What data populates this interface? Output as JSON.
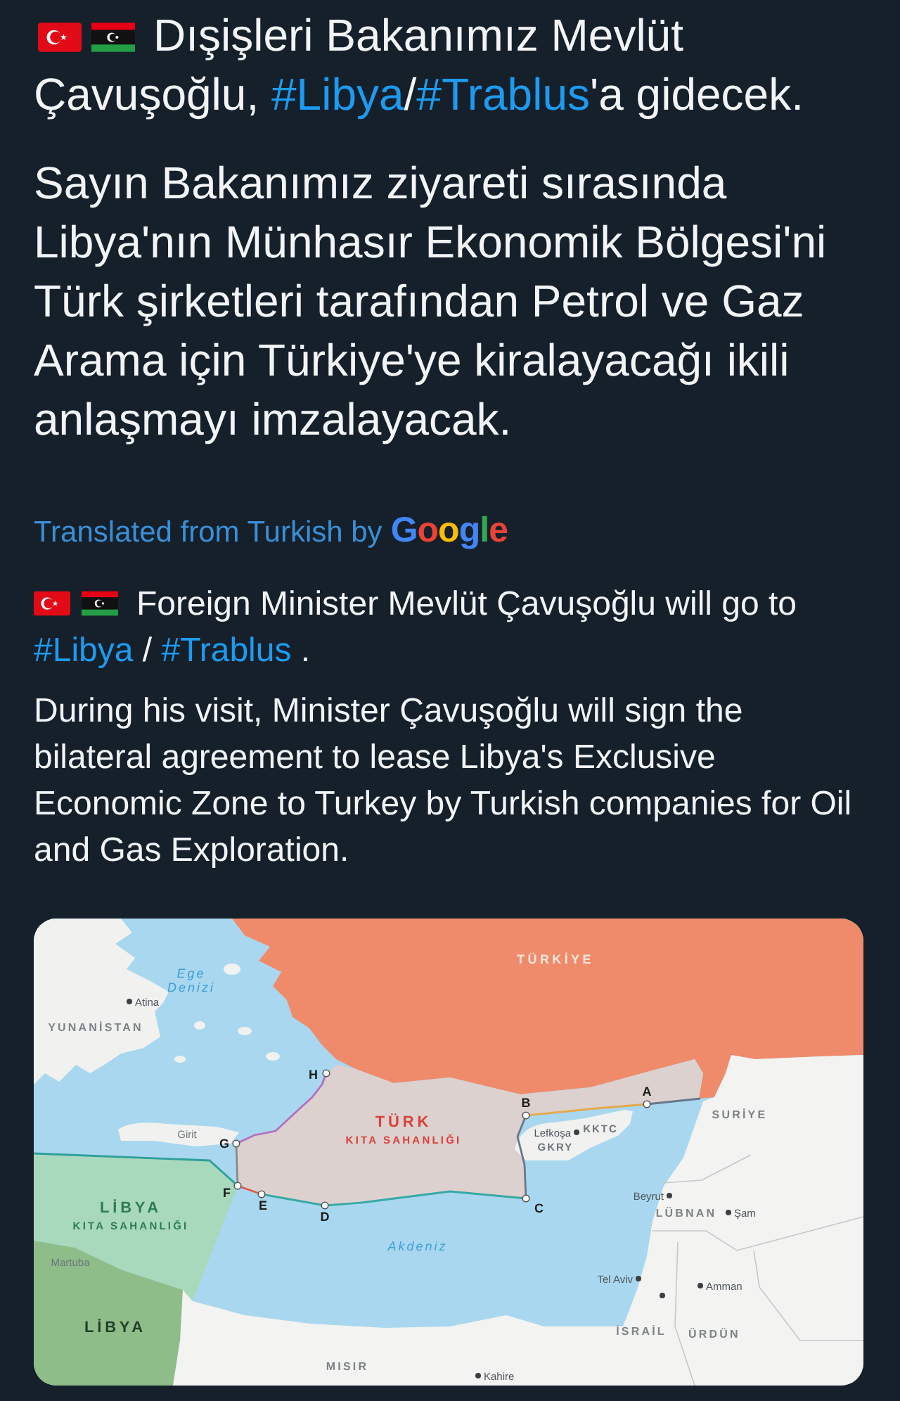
{
  "original": {
    "headline": [
      {
        "kind": "text",
        "text": "Dışişleri Bakanımız Mevlüt Çavuşoğlu, "
      },
      {
        "kind": "hashtag",
        "text": "#Libya"
      },
      {
        "kind": "text",
        "text": "/"
      },
      {
        "kind": "hashtag",
        "text": "#Trablus"
      },
      {
        "kind": "text",
        "text": "'a gidecek."
      }
    ],
    "body": "Sayın Bakanımız ziyareti sırasında Libya'nın Münhasır Ekonomik Bölgesi'ni Türk şirketleri tarafından Petrol ve Gaz Arama için Türkiye'ye kiralayacağı ikili anlaşmayı imzalayacak."
  },
  "translation": {
    "note": "Translated from Turkish by",
    "provider": "Google",
    "headline": [
      {
        "kind": "text",
        "text": "Foreign Minister Mevlüt Çavuşoğlu will go to "
      },
      {
        "kind": "hashtag",
        "text": "#Libya"
      },
      {
        "kind": "text",
        "text": " / "
      },
      {
        "kind": "hashtag",
        "text": "#Trablus"
      },
      {
        "kind": "text",
        "text": " ."
      }
    ],
    "body": "During his visit, Minister Çavuşoğlu will sign the bilateral agreement to lease Libya's Exclusive Economic Zone to Turkey by Turkish companies for Oil and Gas Exploration."
  },
  "map": {
    "countries": [
      "TÜRKİYE",
      "YUNANİSTAN",
      "SURİYE",
      "KKTC",
      "GKRY",
      "LÜBNAN",
      "İSRAİL",
      "ÜRDÜN",
      "LİBYA",
      "MISIR"
    ],
    "zones": [
      {
        "name": "TÜRK",
        "subtitle": "KITA SAHANLIĞI"
      },
      {
        "name": "LİBYA",
        "subtitle": "KITA SAHANLIĞI"
      }
    ],
    "seas": [
      "Ege Denizi",
      "Akdeniz"
    ],
    "cities": [
      "Atina",
      "Lefkoşa",
      "Beyrut",
      "Şam",
      "Tel Aviv",
      "Amman",
      "Kahire"
    ],
    "places": [
      "Girit",
      "Martuba"
    ],
    "points": [
      "A",
      "B",
      "C",
      "D",
      "E",
      "F",
      "G",
      "H"
    ]
  }
}
